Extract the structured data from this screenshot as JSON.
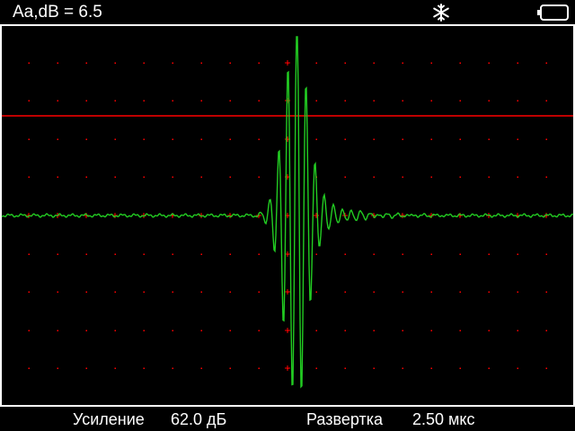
{
  "header": {
    "title": "Aa,dB = 6.5",
    "snow_icon": "snowflake-icon",
    "battery_icon": "battery-empty-icon"
  },
  "footer": {
    "gain_label": "Усиление",
    "gain_value": "62.0 дБ",
    "sweep_label": "Развертка",
    "sweep_value": "2.50 мкс"
  },
  "colors": {
    "background": "#000000",
    "frame": "#ffffff",
    "grid_marks": "#ff0000",
    "gate_line": "#ff0000",
    "waveform": "#22cc22"
  }
}
